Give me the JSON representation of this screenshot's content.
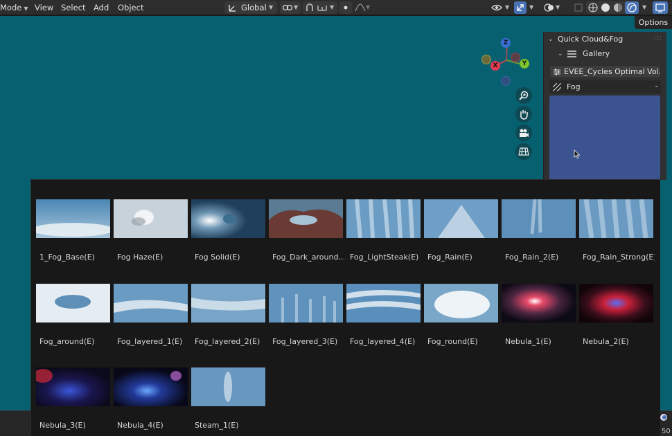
{
  "header": {
    "mode_label": "Mode",
    "menus": [
      "View",
      "Select",
      "Add",
      "Object"
    ],
    "transform_orientation": "Global"
  },
  "options_label": "Options",
  "gizmo": {
    "z": "Z",
    "x": "X",
    "y": "Y"
  },
  "sidebar": {
    "panel_title": "Quick Cloud&Fog",
    "subpanel_title": "Gallery",
    "preset_field": "EVEE_Cycles Optimal Vol...",
    "category_value": "Fog"
  },
  "gallery": {
    "items": [
      {
        "label": "1_Fog_Base(E)"
      },
      {
        "label": "Fog Haze(E)"
      },
      {
        "label": "Fog Solid(E)"
      },
      {
        "label": "Fog_Dark_around..."
      },
      {
        "label": "Fog_LightSteak(E)"
      },
      {
        "label": "Fog_Rain(E)"
      },
      {
        "label": "Fog_Rain_2(E)"
      },
      {
        "label": "Fog_Rain_Strong(E)"
      },
      {
        "label": "Fog_around(E)"
      },
      {
        "label": "Fog_layered_1(E)"
      },
      {
        "label": "Fog_layered_2(E)"
      },
      {
        "label": "Fog_layered_3(E)"
      },
      {
        "label": "Fog_layered_4(E)"
      },
      {
        "label": "Fog_round(E)"
      },
      {
        "label": "Nebula_1(E)"
      },
      {
        "label": "Nebula_2(E)"
      },
      {
        "label": "Nebula_3(E)"
      },
      {
        "label": "Nebula_4(E)"
      },
      {
        "label": "Steam_1(E)"
      }
    ]
  },
  "status": {
    "frame_fragment": "50"
  },
  "colors": {
    "viewport": "#07606f",
    "panel": "#303030",
    "popup": "#181818",
    "accent": "#4772b3",
    "preview": "#3b5490"
  }
}
